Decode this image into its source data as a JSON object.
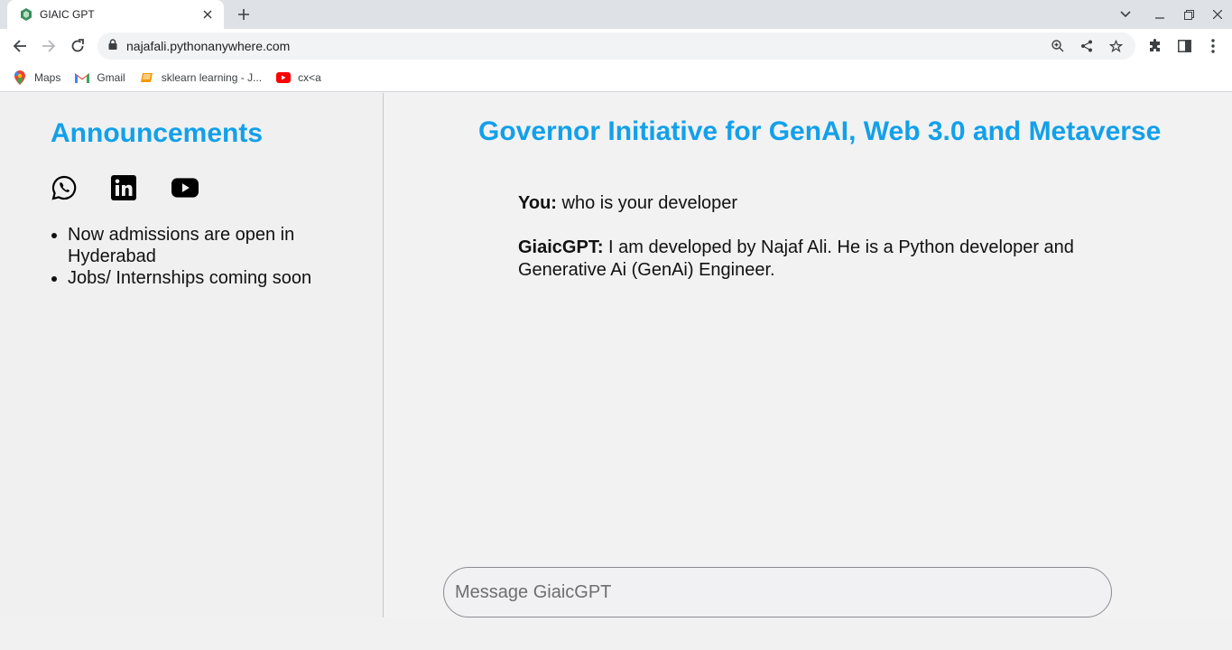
{
  "browser": {
    "tab_title": "GIAIC GPT",
    "url": "najafali.pythonanywhere.com",
    "bookmarks": [
      {
        "label": "Maps",
        "icon": "maps-icon"
      },
      {
        "label": "Gmail",
        "icon": "gmail-icon"
      },
      {
        "label": "sklearn learning - J...",
        "icon": "book-icon"
      },
      {
        "label": "cx<a",
        "icon": "youtube-icon"
      }
    ]
  },
  "sidebar": {
    "title": "Announcements",
    "social": [
      "whatsapp-icon",
      "linkedin-icon",
      "youtube-icon"
    ],
    "announcements": [
      "Now admissions are open in Hyderabad",
      "Jobs/ Internships coming soon"
    ]
  },
  "main": {
    "title": "Governor Initiative for GenAI, Web 3.0 and Metaverse",
    "messages": [
      {
        "sender": "You:",
        "text": " who is your developer"
      },
      {
        "sender": "GiaicGPT:",
        "text": " I am developed by Najaf Ali. He is a Python developer and Generative Ai (GenAi) Engineer."
      }
    ],
    "input_placeholder": "Message GiaicGPT"
  },
  "colors": {
    "accent": "#12a0ea",
    "tabstrip": "#dee1e6"
  }
}
